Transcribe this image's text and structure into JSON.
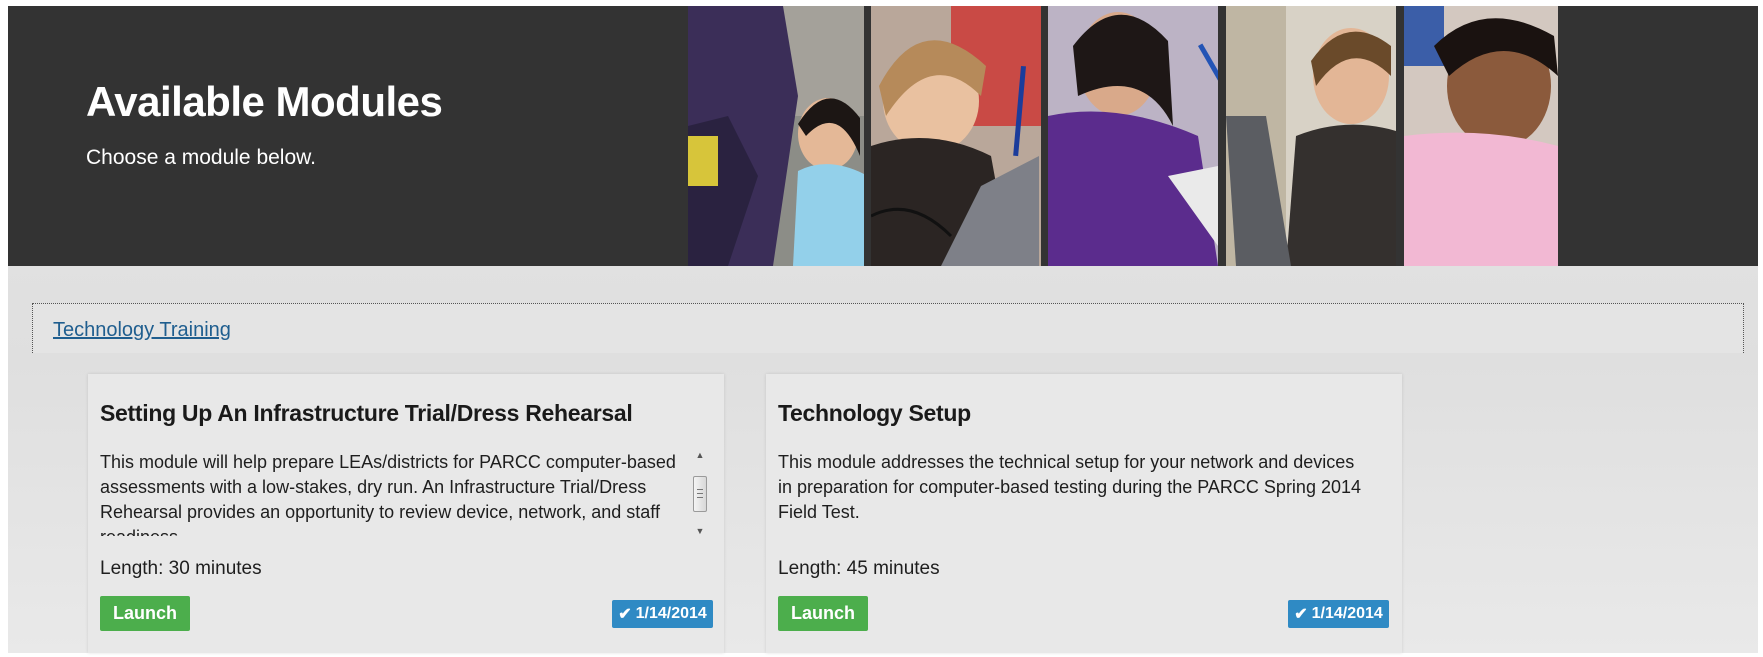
{
  "banner": {
    "title": "Available Modules",
    "subtitle": "Choose a module below."
  },
  "section": {
    "title": "Technology Training"
  },
  "modules": [
    {
      "title": "Setting Up An Infrastructure Trial/Dress Rehearsal",
      "description": "This module will help prepare LEAs/districts for PARCC computer-based assessments with a low-stakes, dry run. An Infrastructure Trial/Dress Rehearsal provides an opportunity to review device, network, and staff readiness.",
      "length": "Length: 30 minutes",
      "launch_label": "Launch",
      "date": "1/14/2014"
    },
    {
      "title": "Technology Setup",
      "description": "This module addresses the technical setup for your network and devices in preparation for computer-based testing during the PARCC Spring 2014 Field Test.",
      "length": "Length: 45 minutes",
      "launch_label": "Launch",
      "date": "1/14/2014"
    }
  ],
  "icons": {
    "check": "check-icon",
    "scroll_up": "scroll-up-icon",
    "scroll_down": "scroll-down-icon"
  },
  "colors": {
    "banner_bg": "#333333",
    "launch_green": "#4cae4c",
    "badge_blue": "#2f8ac4",
    "link_blue": "#1f5e8f"
  }
}
